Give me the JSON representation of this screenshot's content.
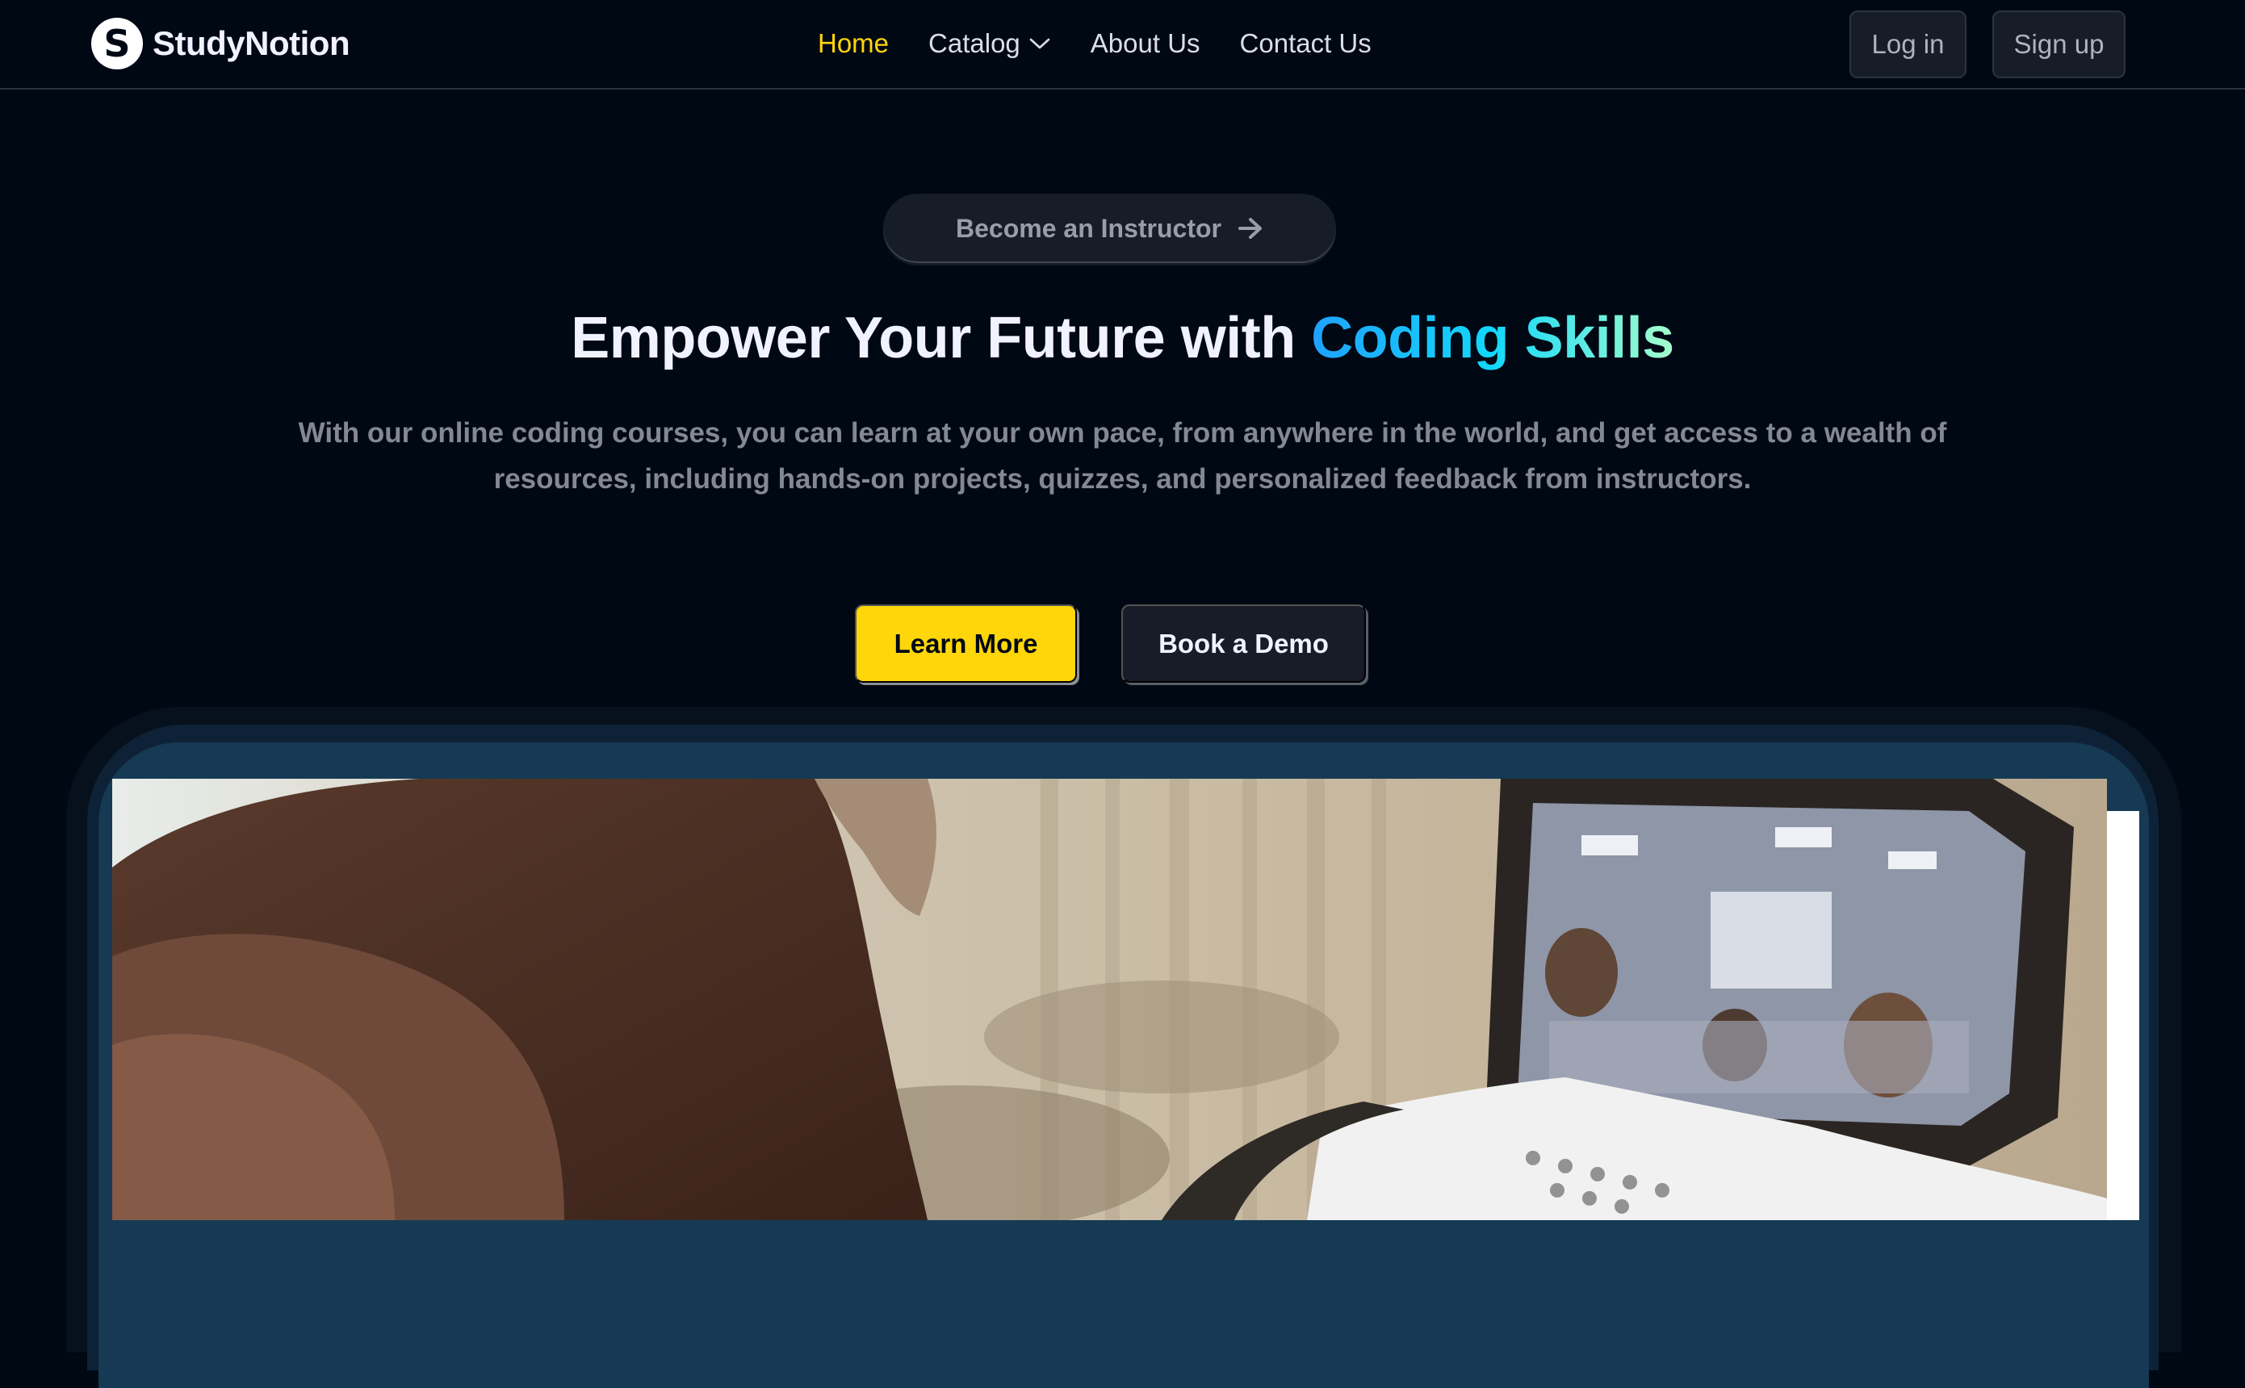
{
  "navbar": {
    "logo": {
      "mark": "S",
      "text": "StudyNotion"
    },
    "links": [
      {
        "label": "Home",
        "active": true
      },
      {
        "label": "Catalog",
        "icon": "chevron-down-icon"
      },
      {
        "label": "About Us"
      },
      {
        "label": "Contact Us"
      }
    ],
    "login_label": "Log in",
    "signup_label": "Sign up"
  },
  "hero": {
    "instructor_button": {
      "label": "Become an Instructor",
      "icon": "arrow-right-icon"
    },
    "headline_prefix": "Empower Your Future with ",
    "headline_highlight": "Coding Skills",
    "subtext_lines": [
      "With our online coding courses, you can learn at your own pace, from anywhere in the world, and get access to a wealth of",
      "resources, including hands-on projects, quizzes, and personalized feedback from instructors."
    ],
    "learn_more_label": "Learn More",
    "book_demo_label": "Book a Demo"
  },
  "colors": {
    "background": "#000814",
    "accent_yellow": "#ffd60a",
    "highlight_gradient": [
      "#1fa2ff",
      "#12d8fa",
      "#a6ffcb"
    ],
    "muted_text": "#838894"
  }
}
